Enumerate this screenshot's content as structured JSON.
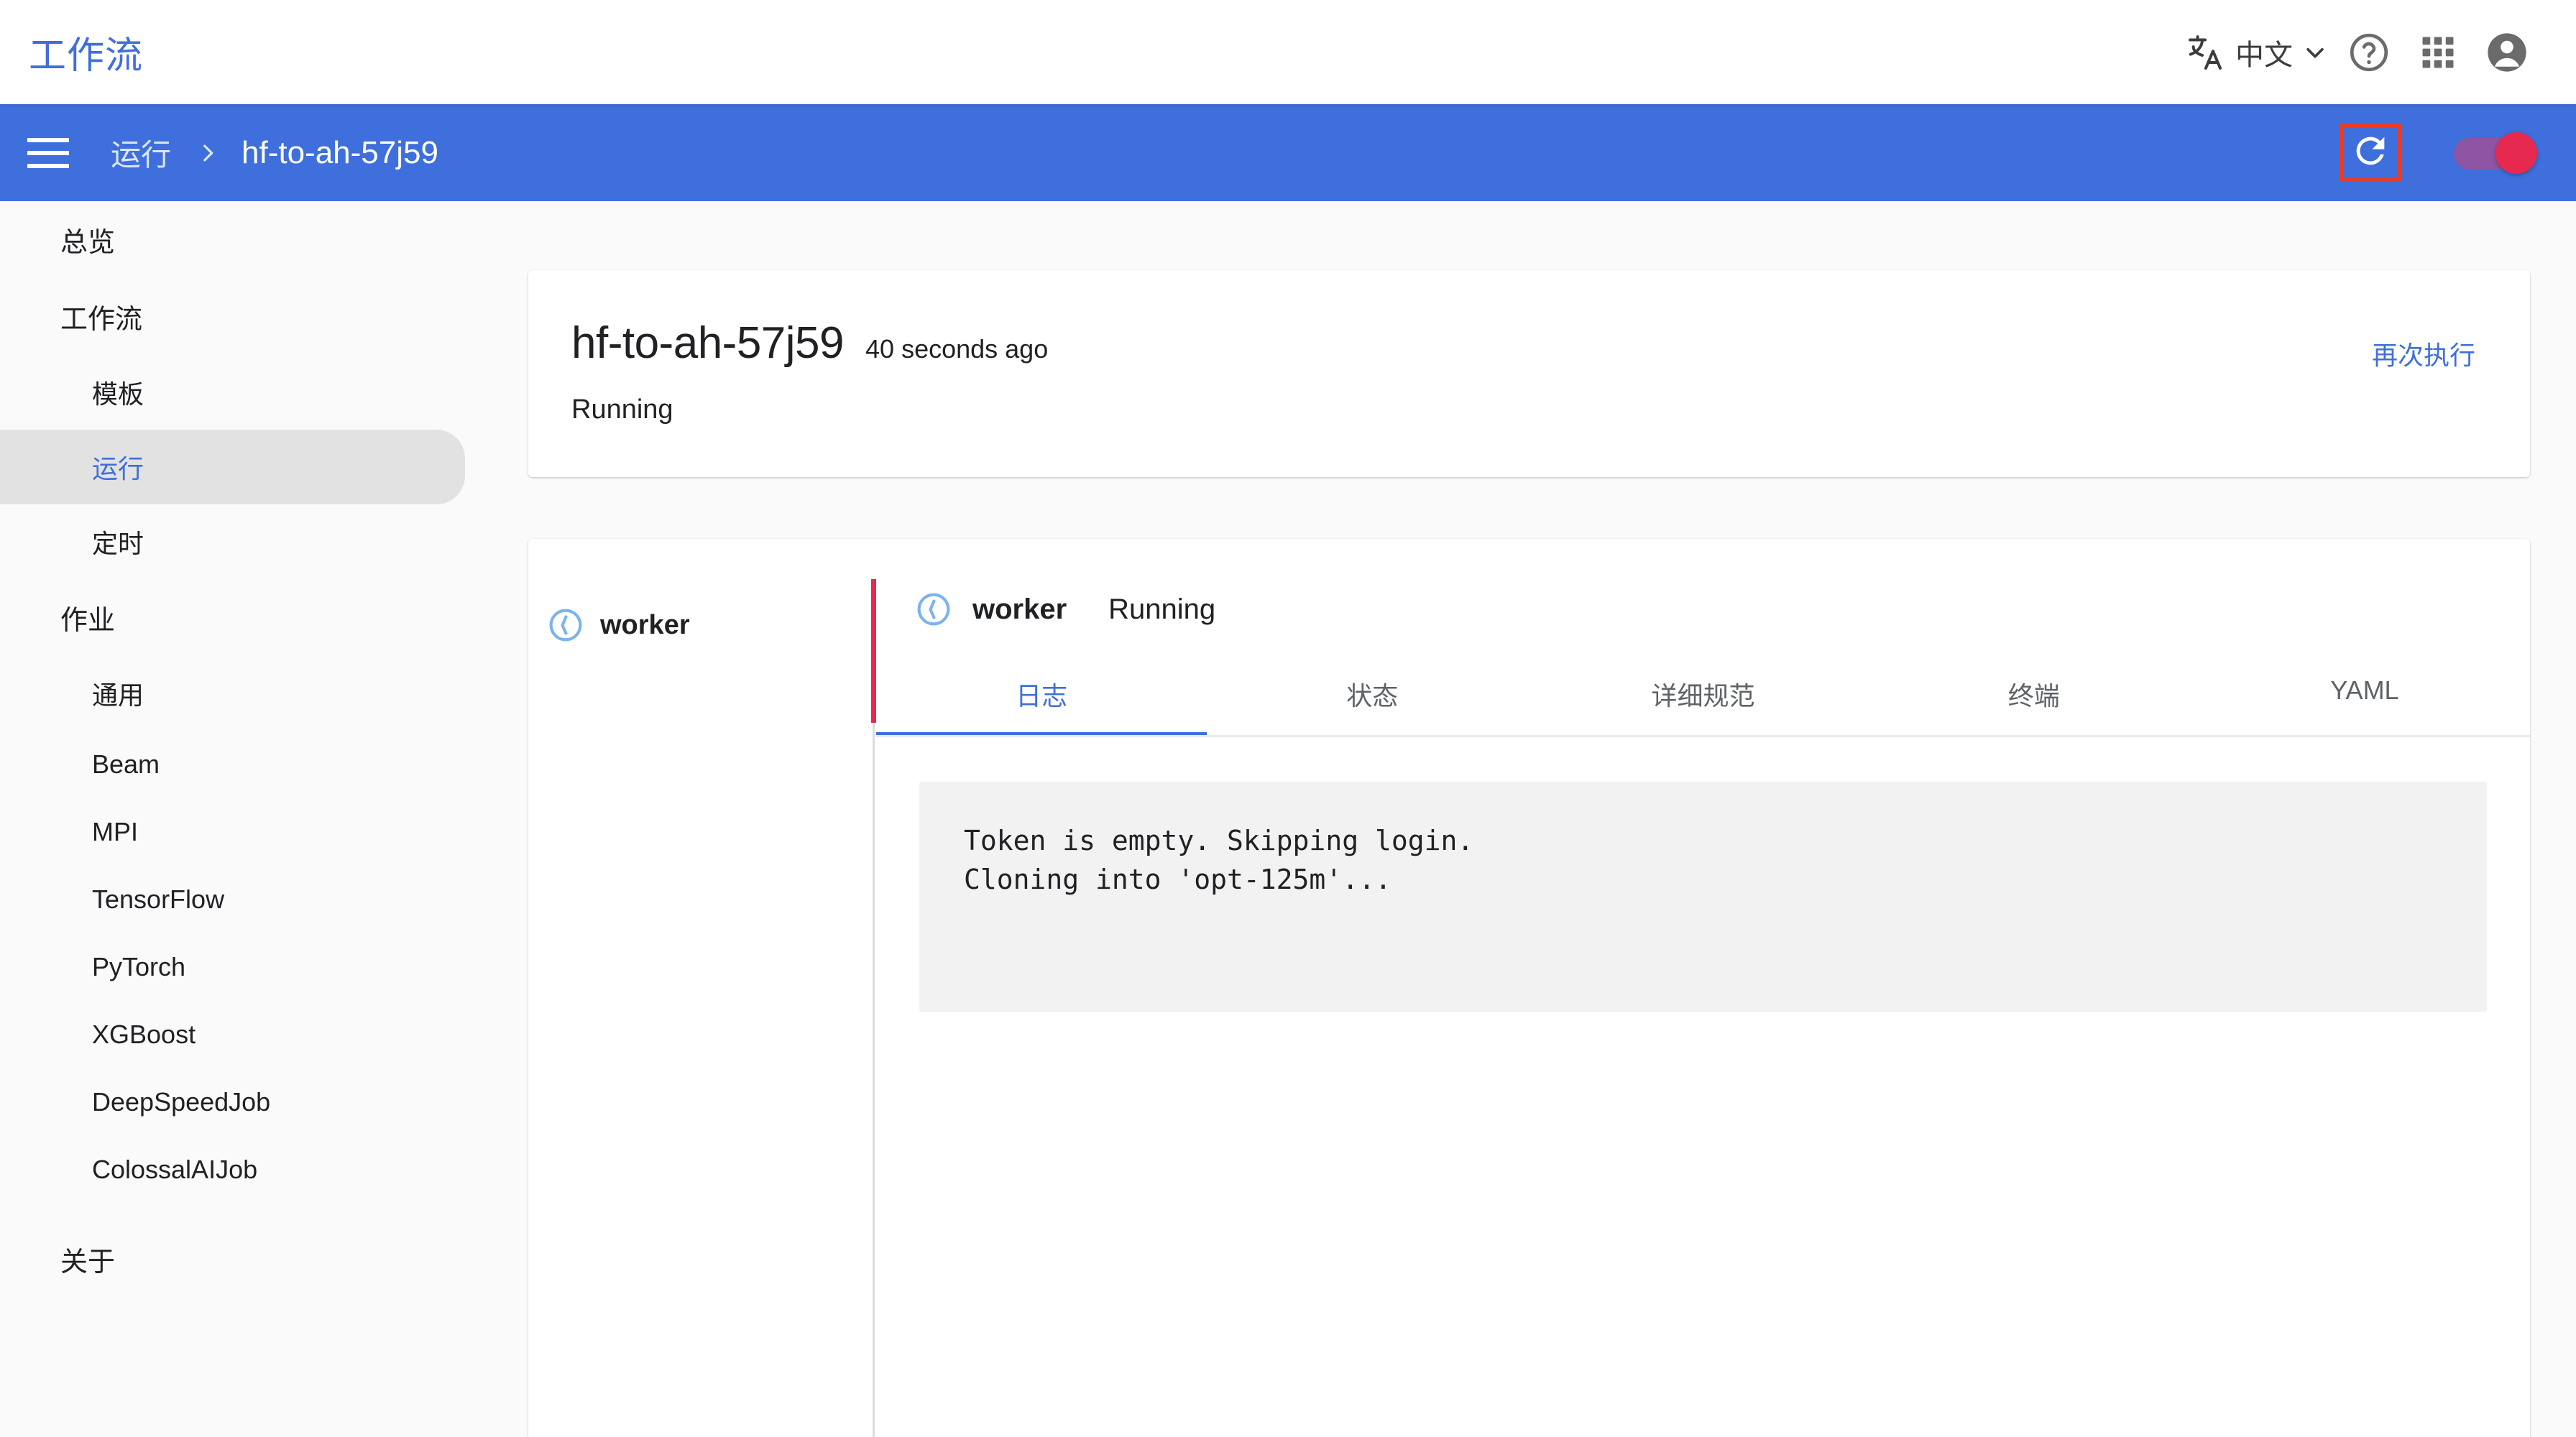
{
  "app": {
    "brand": "工作流",
    "accent_blue": "#3f6fdc",
    "annotation_red": "#ea3c22",
    "status_red": "#e6294f"
  },
  "topbar": {
    "language_icon": "translate-icon",
    "language_label": "中文",
    "chevron_icon": "chevron-down-icon",
    "help_icon": "help-circle-icon",
    "apps_icon": "apps-grid-icon",
    "account_icon": "account-circle-icon"
  },
  "breadcrumb": {
    "menu_icon": "hamburger-menu-icon",
    "parent": "运行",
    "separator": "›",
    "current": "hf-to-ah-57j59",
    "refresh_icon": "refresh-icon",
    "toggle_state": "on"
  },
  "sidebar": {
    "items": [
      {
        "label": "总览",
        "type": "top",
        "active": false
      },
      {
        "label": "工作流",
        "type": "section",
        "active": false
      },
      {
        "label": "模板",
        "type": "sub",
        "active": false
      },
      {
        "label": "运行",
        "type": "sub",
        "active": true
      },
      {
        "label": "定时",
        "type": "sub",
        "active": false
      },
      {
        "label": "作业",
        "type": "section",
        "active": false
      },
      {
        "label": "通用",
        "type": "sub",
        "active": false
      },
      {
        "label": "Beam",
        "type": "sub",
        "active": false
      },
      {
        "label": "MPI",
        "type": "sub",
        "active": false
      },
      {
        "label": "TensorFlow",
        "type": "sub",
        "active": false
      },
      {
        "label": "PyTorch",
        "type": "sub",
        "active": false
      },
      {
        "label": "XGBoost",
        "type": "sub",
        "active": false
      },
      {
        "label": "DeepSpeedJob",
        "type": "sub",
        "active": false
      },
      {
        "label": "ColossalAIJob",
        "type": "sub",
        "active": false
      },
      {
        "label": "关于",
        "type": "top",
        "active": false
      }
    ]
  },
  "summary": {
    "run_name": "hf-to-ah-57j59",
    "age": "40 seconds ago",
    "status": "Running",
    "rerun_label": "再次执行"
  },
  "detail": {
    "worker_list": [
      {
        "name": "worker",
        "status_icon": "pending-clock-icon"
      }
    ],
    "panel": {
      "icon": "pending-clock-icon",
      "name": "worker",
      "state": "Running"
    },
    "tabs": [
      {
        "label": "日志",
        "active": true
      },
      {
        "label": "状态",
        "active": false
      },
      {
        "label": "详细规范",
        "active": false
      },
      {
        "label": "终端",
        "active": false
      },
      {
        "label": "YAML",
        "active": false
      }
    ],
    "log_lines": [
      "Token is empty. Skipping login.",
      "Cloning into 'opt-125m'..."
    ]
  }
}
